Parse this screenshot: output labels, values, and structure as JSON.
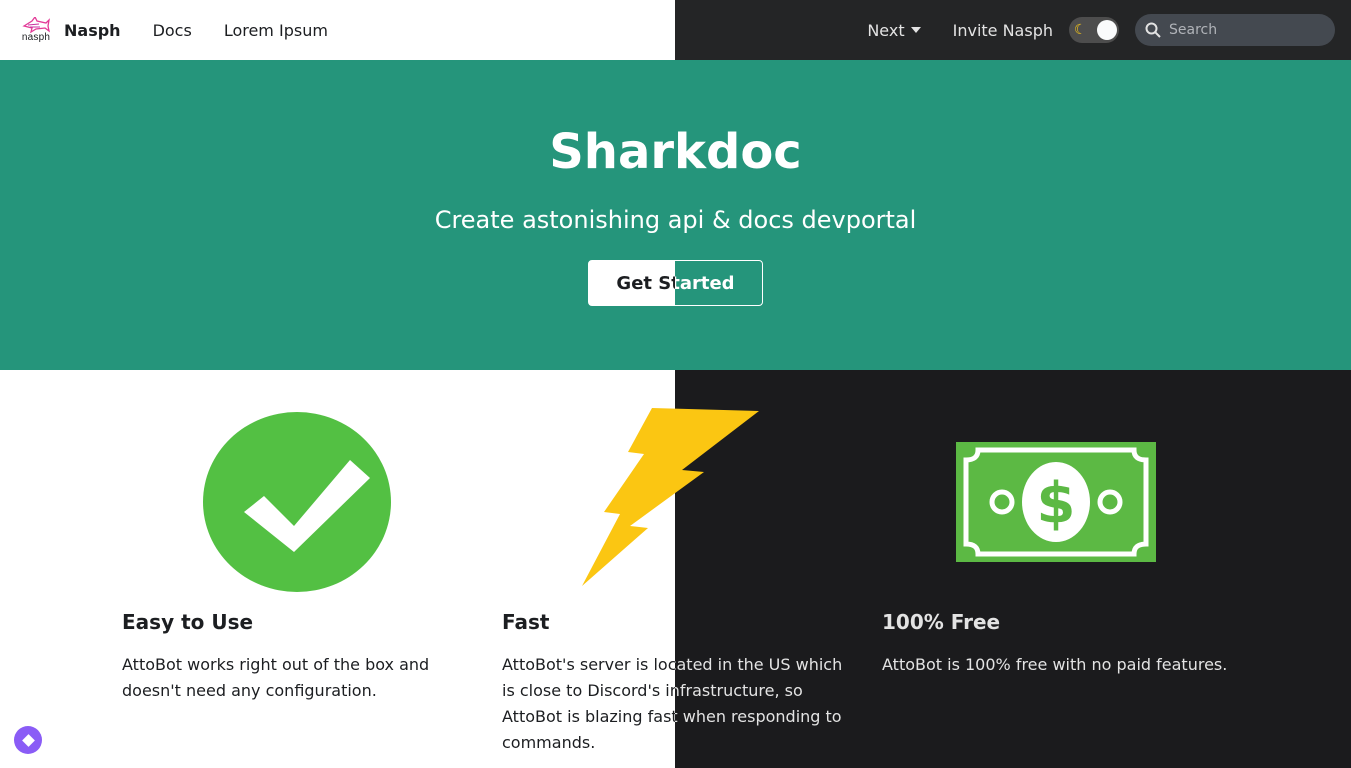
{
  "navbar": {
    "logo_text": "nasph",
    "brand": "Nasph",
    "links": [
      "Docs",
      "Lorem Ipsum"
    ],
    "next": "Next",
    "invite": "Invite Nasph",
    "search_placeholder": "Search",
    "theme_toggle_icon": "moon-icon"
  },
  "hero": {
    "title": "Sharkdoc",
    "subtitle": "Create astonishing api & docs devportal",
    "cta": "Get Started",
    "background": "#25957b"
  },
  "features": [
    {
      "icon": "checkmark-circle-icon",
      "title": "Easy to Use",
      "description": "AttoBot works right out of the box and doesn't need any configuration."
    },
    {
      "icon": "lightning-bolt-icon",
      "title": "Fast",
      "description": "AttoBot's server is located in the US which is close to Discord's infrastructure, so AttoBot is blazing fast when responding to commands."
    },
    {
      "icon": "dollar-bill-icon",
      "title": "100% Free",
      "description": "AttoBot is 100% free with no paid features."
    }
  ],
  "colors": {
    "accent": "#25957b",
    "check_green": "#53c043",
    "bolt_yellow": "#fbc612",
    "bill_green": "#5cb944",
    "assistant_purple": "#8a5cf6"
  }
}
